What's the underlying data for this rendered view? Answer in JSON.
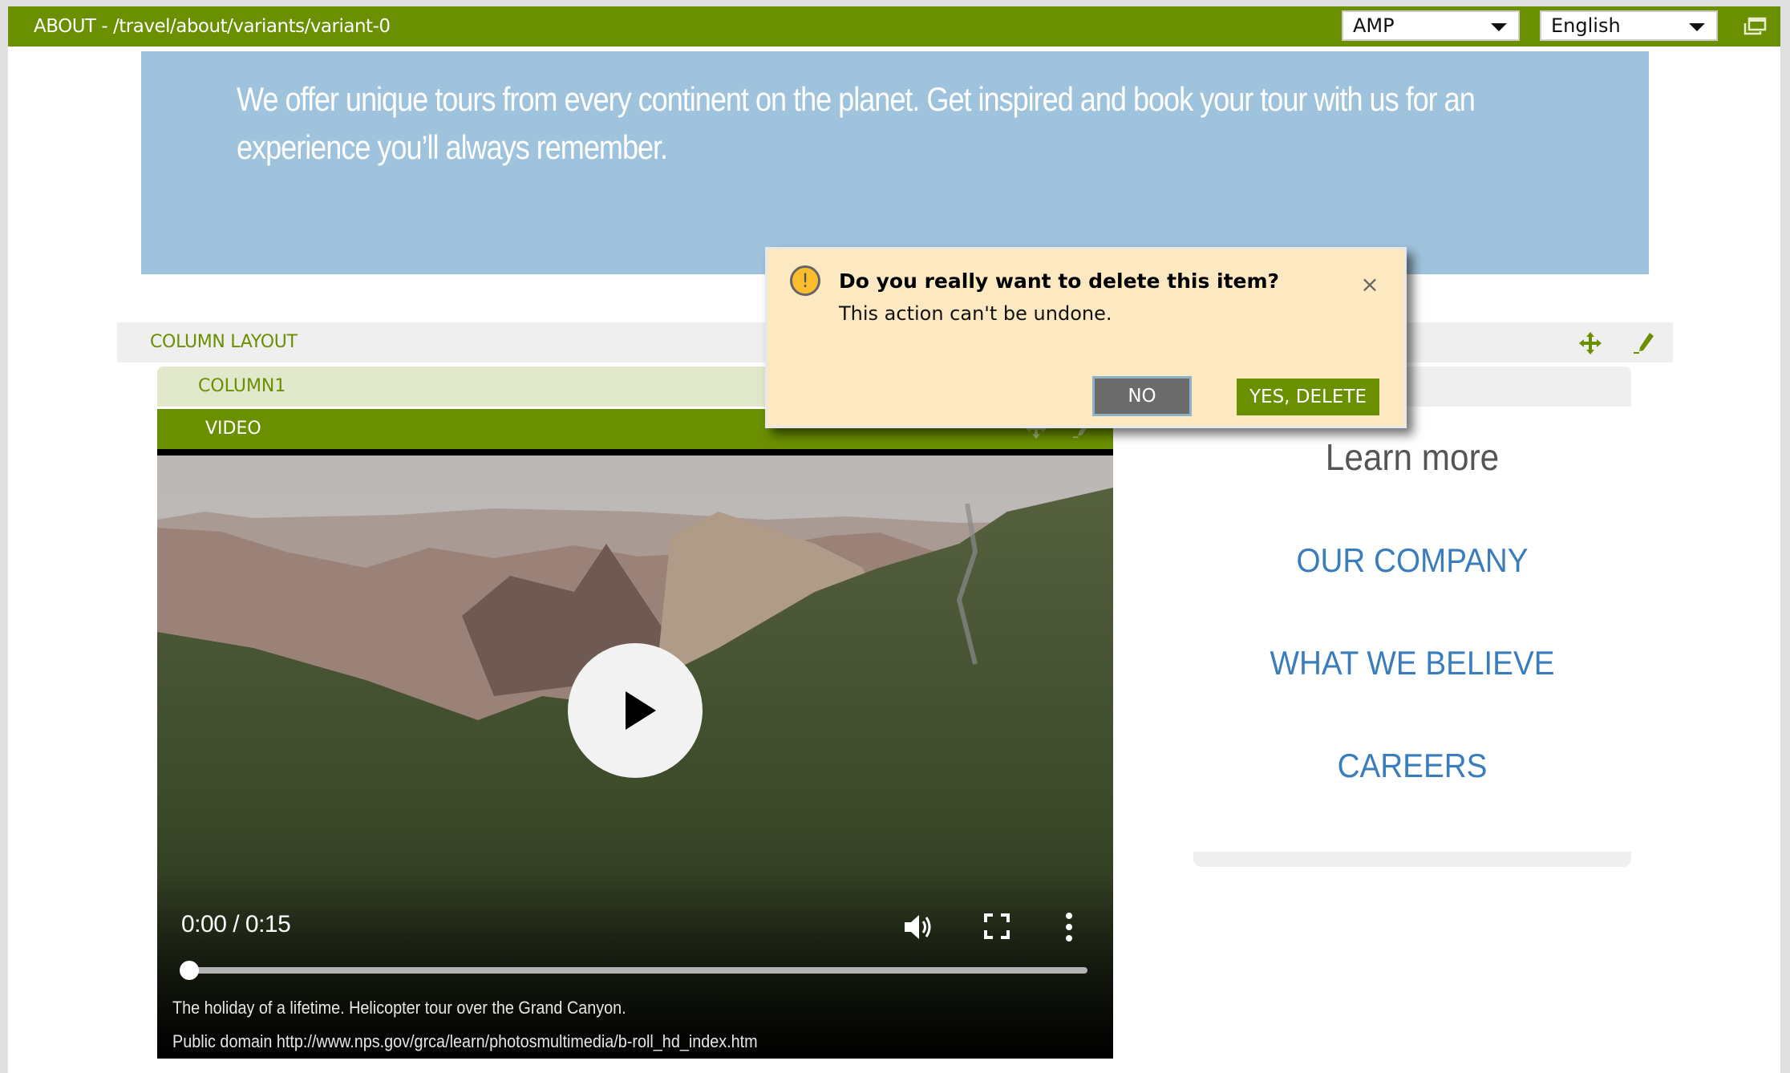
{
  "header": {
    "title": "ABOUT - /travel/about/variants/variant-0",
    "channel_select": {
      "selected": "AMP"
    },
    "language_select": {
      "selected": "English"
    },
    "icons": {
      "window": "restore-window-icon"
    }
  },
  "colors": {
    "brand_green": "#6a8f00",
    "hero_blue": "#a0c3dd",
    "dialog_bg": "#fde9c1",
    "link_blue": "#3a7dbd",
    "warning_yellow": "#fbbd2d"
  },
  "hero": {
    "text": "We offer unique tours from every continent on the planet. Get inspired and book your tour with us for an experience you’ll always remember."
  },
  "column_layout": {
    "label": "COLUMN LAYOUT",
    "icons": [
      "move-icon",
      "edit-icon"
    ],
    "column1": {
      "label": "COLUMN1"
    },
    "video_component": {
      "label": "VIDEO"
    }
  },
  "video": {
    "time": "0:00 / 0:15",
    "progress": 0,
    "caption_lines": [
      "The holiday of a lifetime. Helicopter tour over the Grand Canyon.",
      "Public domain http://www.nps.gov/grca/learn/photosmultimedia/b-roll_hd_index.htm"
    ],
    "icons": [
      "play-icon",
      "volume-icon",
      "fullscreen-icon",
      "more-options-icon"
    ]
  },
  "right_column": {
    "heading": "Learn more",
    "links": [
      "OUR COMPANY",
      "WHAT WE BELIEVE",
      "CAREERS"
    ]
  },
  "dialog": {
    "title": "Do you really want to delete this item?",
    "message": "This action can't be undone.",
    "close_label": "×",
    "no_label": "NO",
    "yes_label": "YES, DELETE"
  }
}
